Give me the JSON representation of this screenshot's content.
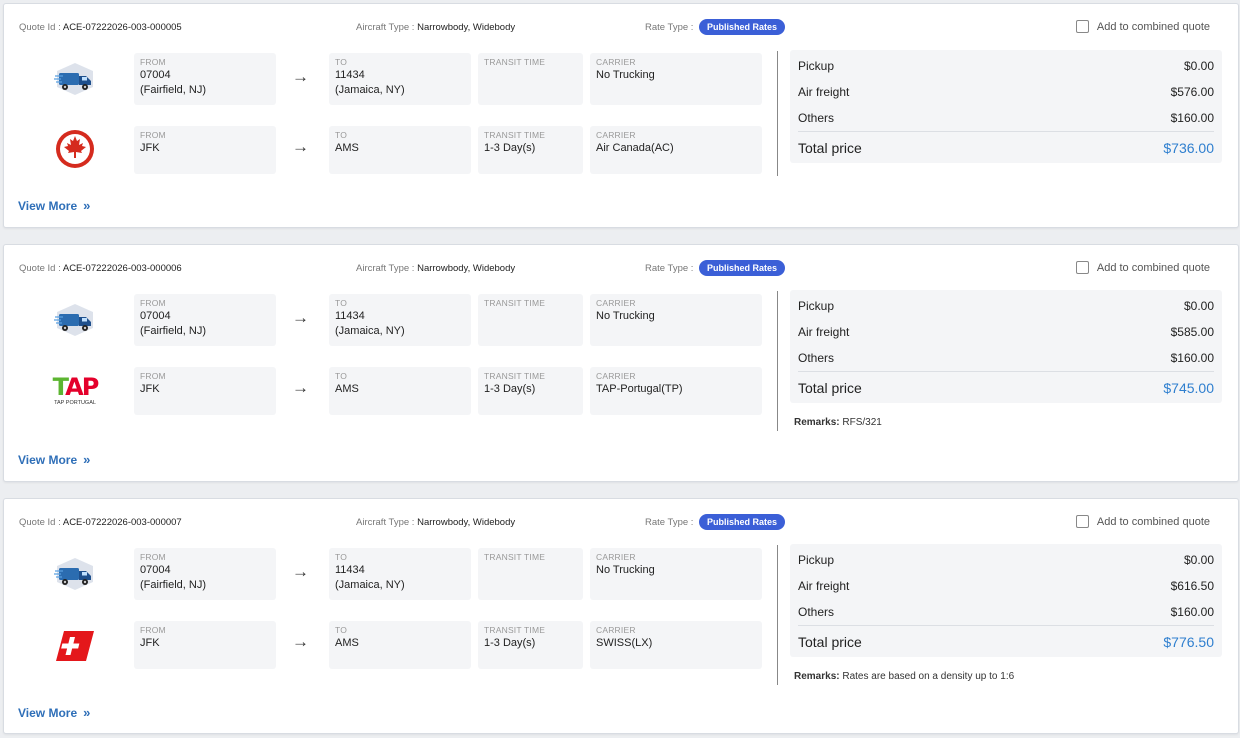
{
  "labels": {
    "quote_id": "Quote Id :",
    "aircraft_type": "Aircraft Type :",
    "rate_type": "Rate Type :",
    "combine": "Add to combined quote",
    "from": "FROM",
    "to": "TO",
    "transit": "TRANSIT TIME",
    "carrier": "CARRIER",
    "pickup": "Pickup",
    "air_freight": "Air freight",
    "others": "Others",
    "total": "Total price",
    "remarks": "Remarks:",
    "view_more": "View More",
    "arrow": "→",
    "chevron": "»"
  },
  "quotes": [
    {
      "id": "ACE-07222026-003-000005",
      "aircraft": "Narrowbody, Widebody",
      "rate": "Published Rates",
      "truck": {
        "from_line1": "07004",
        "from_line2": "(Fairfield, NJ)",
        "to_line1": "11434",
        "to_line2": "(Jamaica, NY)",
        "transit": "",
        "carrier": "No Trucking"
      },
      "air": {
        "logo": "air-canada-logo",
        "from": "JFK",
        "to": "AMS",
        "transit": "1-3 Day(s)",
        "carrier": "Air Canada(AC)"
      },
      "pickup": "$0.00",
      "air_freight": "$576.00",
      "others": "$160.00",
      "total": "$736.00",
      "remarks": ""
    },
    {
      "id": "ACE-07222026-003-000006",
      "aircraft": "Narrowbody, Widebody",
      "rate": "Published Rates",
      "truck": {
        "from_line1": "07004",
        "from_line2": "(Fairfield, NJ)",
        "to_line1": "11434",
        "to_line2": "(Jamaica, NY)",
        "transit": "",
        "carrier": "No Trucking"
      },
      "air": {
        "logo": "tap-portugal-logo",
        "logo_text": "TAP",
        "logo_sub": "TAP PORTUGAL",
        "from": "JFK",
        "to": "AMS",
        "transit": "1-3 Day(s)",
        "carrier": "TAP-Portugal(TP)"
      },
      "pickup": "$0.00",
      "air_freight": "$585.00",
      "others": "$160.00",
      "total": "$745.00",
      "remarks": "RFS/321"
    },
    {
      "id": "ACE-07222026-003-000007",
      "aircraft": "Narrowbody, Widebody",
      "rate": "Published Rates",
      "truck": {
        "from_line1": "07004",
        "from_line2": "(Fairfield, NJ)",
        "to_line1": "11434",
        "to_line2": "(Jamaica, NY)",
        "transit": "",
        "carrier": "No Trucking"
      },
      "air": {
        "logo": "swiss-logo",
        "from": "JFK",
        "to": "AMS",
        "transit": "1-3 Day(s)",
        "carrier": "SWISS(LX)"
      },
      "pickup": "$0.00",
      "air_freight": "$616.50",
      "others": "$160.00",
      "total": "$776.50",
      "remarks": "Rates are based on a density up to 1:6"
    }
  ],
  "colors": {
    "badge": "#3b5fd7",
    "link": "#2f6fb8",
    "total": "#2f7fcf",
    "air_canada": "#d52b1e",
    "tap_green": "#5cb531",
    "tap_red": "#e4002b",
    "swiss": "#e4171b"
  }
}
